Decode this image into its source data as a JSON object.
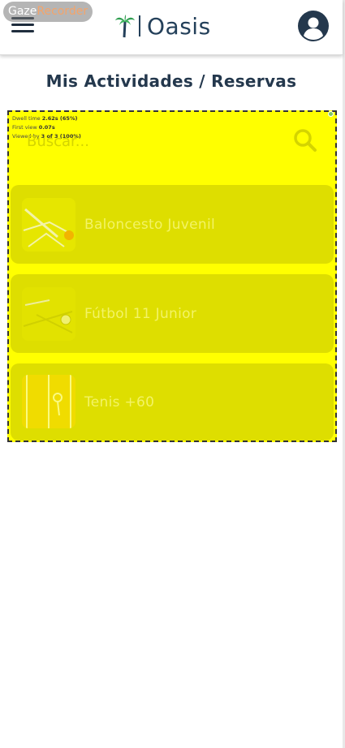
{
  "header": {
    "logo_text": "Oasis"
  },
  "watermark": {
    "part1": "Gaze",
    "part2": "Recorder"
  },
  "title": "Mis Actividades /  Reservas",
  "overlay_stats": {
    "dwell_label": "Dwell time",
    "dwell_value": "2.62s (65%)",
    "first_label": "First view",
    "first_value": "0.07s",
    "viewed_label": "Viewed by",
    "viewed_value": "3 of 3 (100%)"
  },
  "search": {
    "placeholder": "Buscar..."
  },
  "activities": [
    {
      "label": "Baloncesto Juvenil",
      "icon": "basketball-icon"
    },
    {
      "label": "Fútbol 11 Junior",
      "icon": "soccer-icon"
    },
    {
      "label": "Tenis +60",
      "icon": "tennis-icon"
    }
  ],
  "colors": {
    "brand_navy": "#24384d",
    "palm_green": "#2e9e4f",
    "overlay_yellow": "#ffff00"
  }
}
